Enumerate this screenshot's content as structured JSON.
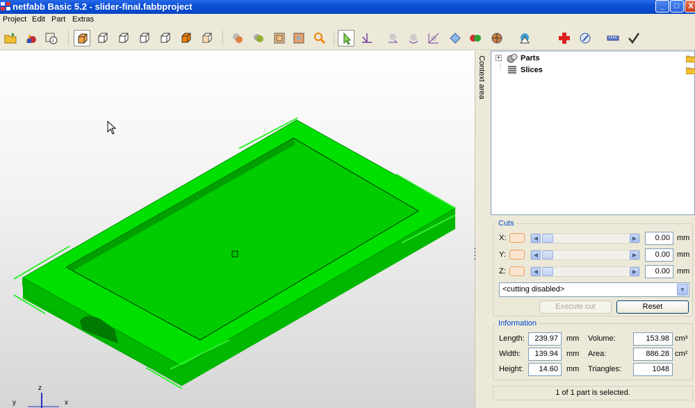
{
  "window": {
    "title": "netfabb Basic 5.2 - slider-final.fabbproject",
    "minimize": "_",
    "maximize": "□",
    "close": "X"
  },
  "menu": [
    "Project",
    "Edit",
    "Part",
    "Extras"
  ],
  "toolbar_icons": [
    "open-project-icon",
    "add-part-icon",
    "project-info-icon",
    "view-iso-icon",
    "view-front-icon",
    "view-back-icon",
    "view-left-icon",
    "view-right-icon",
    "view-top-icon",
    "view-bottom-icon",
    "shading-icon",
    "color-icon",
    "wireframe-icon",
    "bounding-box-icon",
    "zoom-icon",
    "select-tool-icon",
    "measure-icon",
    "move-icon",
    "rotate-icon",
    "scale-icon",
    "orientation-icon",
    "merge-icon",
    "cut-icon",
    "analysis-icon",
    "repair-icon",
    "export-icon",
    "ruler-icon",
    "apply-icon"
  ],
  "context_tab": "Context area",
  "tree": {
    "items": [
      {
        "label": "Parts",
        "expander": "+"
      },
      {
        "label": "Slices",
        "expander": ""
      }
    ]
  },
  "cuts": {
    "title": "Cuts",
    "axes": [
      {
        "label": "X:",
        "value": "0.00",
        "unit": "mm"
      },
      {
        "label": "Y:",
        "value": "0.00",
        "unit": "mm"
      },
      {
        "label": "Z:",
        "value": "0.00",
        "unit": "mm"
      }
    ],
    "mode": "<cutting disabled>",
    "execute_label": "Execute cut",
    "reset_label": "Reset"
  },
  "information": {
    "title": "Information",
    "length_label": "Length:",
    "length": "239.97",
    "length_unit": "mm",
    "width_label": "Width:",
    "width": "139.94",
    "width_unit": "mm",
    "height_label": "Height:",
    "height": "14.60",
    "height_unit": "mm",
    "volume_label": "Volume:",
    "volume": "153.98",
    "volume_unit": "cm³",
    "area_label": "Area:",
    "area": "886.28",
    "area_unit": "cm²",
    "triangles_label": "Triangles:",
    "triangles": "1048"
  },
  "status": "1 of 1 part is selected.",
  "axes_gizmo": {
    "z": "z",
    "x": "x",
    "y": "y"
  },
  "colors": {
    "part": "#00dd00",
    "selection": "#33ee33",
    "title_bar": "#0a4fd6",
    "group_title": "#0046d5"
  }
}
